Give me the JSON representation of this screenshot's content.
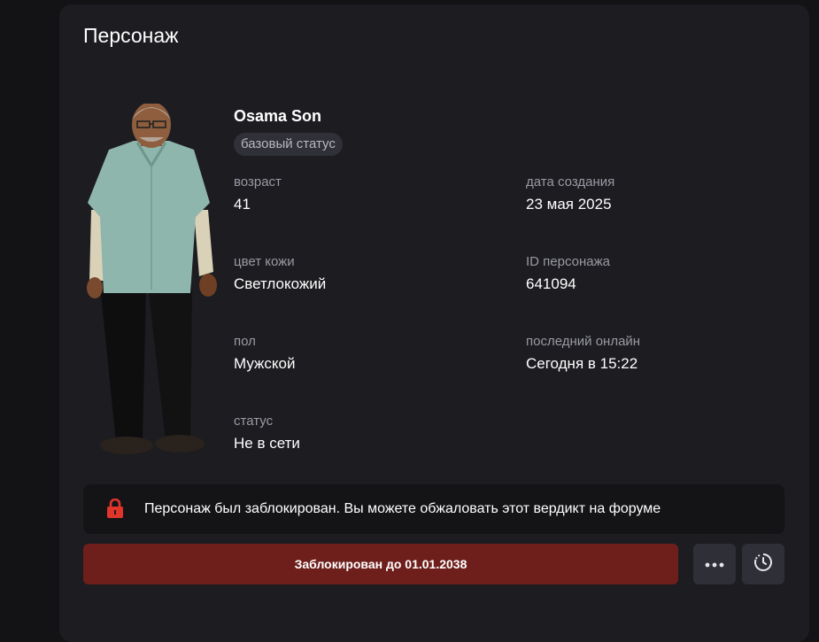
{
  "panel": {
    "title": "Персонаж"
  },
  "character": {
    "name": "Osama Son",
    "status_badge": "базовый статус",
    "fields": {
      "age": {
        "label": "возраст",
        "value": "41"
      },
      "created": {
        "label": "дата создания",
        "value": "23 мая 2025"
      },
      "skin": {
        "label": "цвет кожи",
        "value": "Светлокожий"
      },
      "id": {
        "label": "ID персонажа",
        "value": "641094"
      },
      "gender": {
        "label": "пол",
        "value": "Мужской"
      },
      "last_online": {
        "label": "последний онлайн",
        "value": "Сегодня в 15:22"
      },
      "status": {
        "label": "статус",
        "value": "Не в сети"
      }
    }
  },
  "notice": {
    "icon": "lock-icon",
    "text": "Персонаж был заблокирован. Вы можете обжаловать этот вердикт на форуме"
  },
  "actions": {
    "ban_label": "Заблокирован до 01.01.2038",
    "more_icon": "more-dots-icon",
    "history_icon": "history-clock-icon"
  },
  "colors": {
    "ban_button": "#6e1f1b",
    "lock_icon": "#e0352b",
    "panel": "#1c1c21"
  }
}
